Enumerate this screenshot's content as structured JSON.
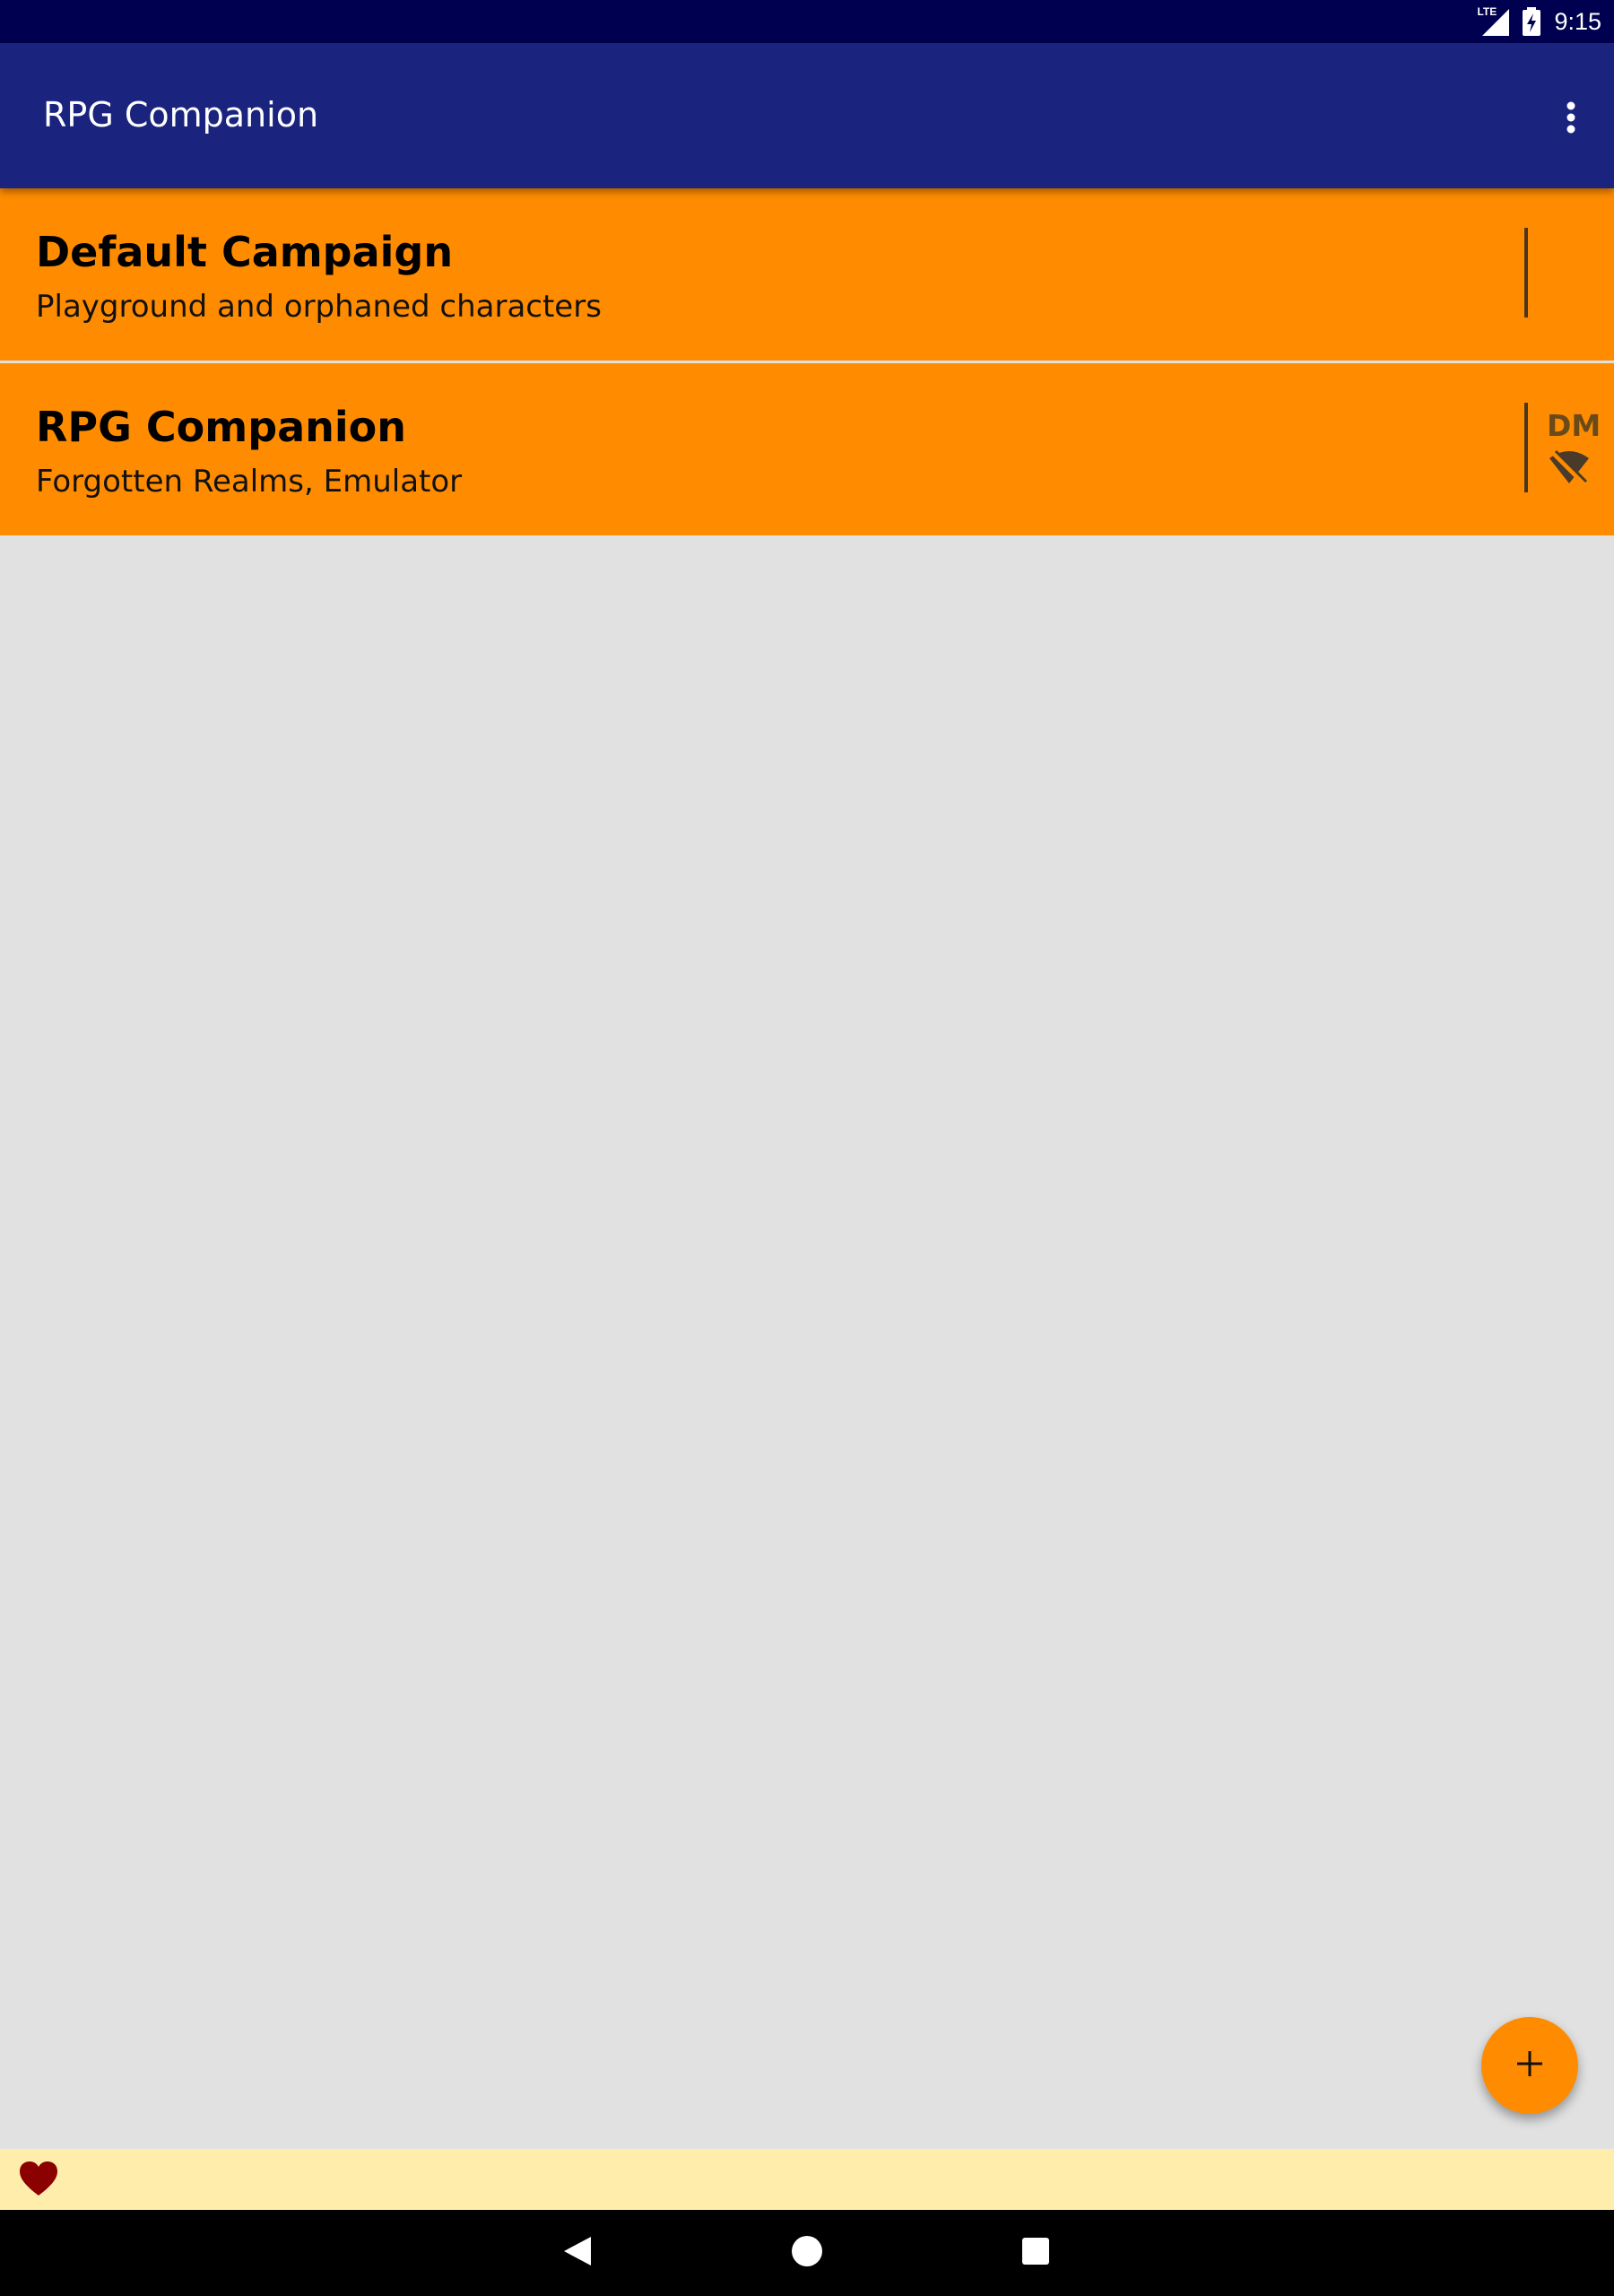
{
  "status_bar": {
    "network_label": "LTE",
    "time": "9:15",
    "icons": [
      "lte-signal-icon",
      "battery-charging-icon"
    ]
  },
  "app_bar": {
    "title": "RPG Companion",
    "overflow_icon": "more-vert-icon"
  },
  "campaigns": [
    {
      "name": "Default Campaign",
      "description": "Playground and orphaned characters",
      "badge": ""
    },
    {
      "name": "RPG Companion",
      "description": "Forgotten Realms, Emulator",
      "badge": "DM",
      "badge_icon": "wifi-off-icon"
    }
  ],
  "fab": {
    "icon": "plus-icon"
  },
  "footer": {
    "icon": "heart-icon"
  },
  "nav": {
    "icons": [
      "back-icon",
      "home-icon",
      "recents-icon"
    ]
  },
  "colors": {
    "status_bar": "#000050",
    "app_bar": "#1a237e",
    "accent": "#ff8c00",
    "background": "#e1e1e1",
    "footer": "#ffeeab",
    "heart": "#8b0000"
  }
}
